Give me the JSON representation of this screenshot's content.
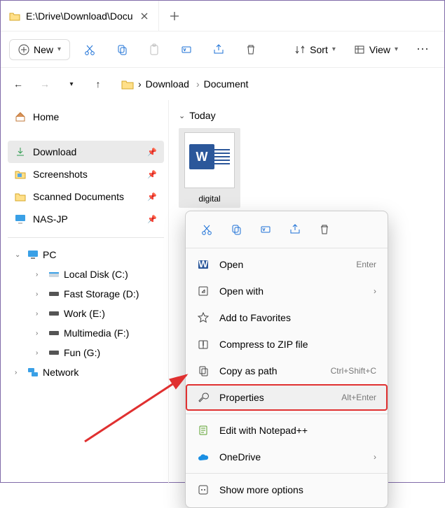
{
  "title": "E:\\Drive\\Download\\Docu",
  "toolbar": {
    "new_label": "New",
    "sort_label": "Sort",
    "view_label": "View"
  },
  "breadcrumbs": [
    "Download",
    "Document"
  ],
  "sidebar": {
    "home": "Home",
    "quick": [
      {
        "label": "Download"
      },
      {
        "label": "Screenshots"
      },
      {
        "label": "Scanned Documents"
      },
      {
        "label": "NAS-JP"
      }
    ],
    "pc_label": "PC",
    "drives": [
      {
        "label": "Local Disk (C:)"
      },
      {
        "label": "Fast Storage (D:)"
      },
      {
        "label": "Work (E:)"
      },
      {
        "label": "Multimedia (F:)"
      },
      {
        "label": "Fun (G:)"
      }
    ],
    "network_label": "Network"
  },
  "group_header": "Today",
  "file": {
    "name": "digital"
  },
  "context_menu": {
    "open": "Open",
    "open_hint": "Enter",
    "open_with": "Open with",
    "favorites": "Add to Favorites",
    "compress": "Compress to ZIP file",
    "copy_path": "Copy as path",
    "copy_path_hint": "Ctrl+Shift+C",
    "properties": "Properties",
    "properties_hint": "Alt+Enter",
    "edit_npp": "Edit with Notepad++",
    "onedrive": "OneDrive",
    "show_more": "Show more options"
  }
}
